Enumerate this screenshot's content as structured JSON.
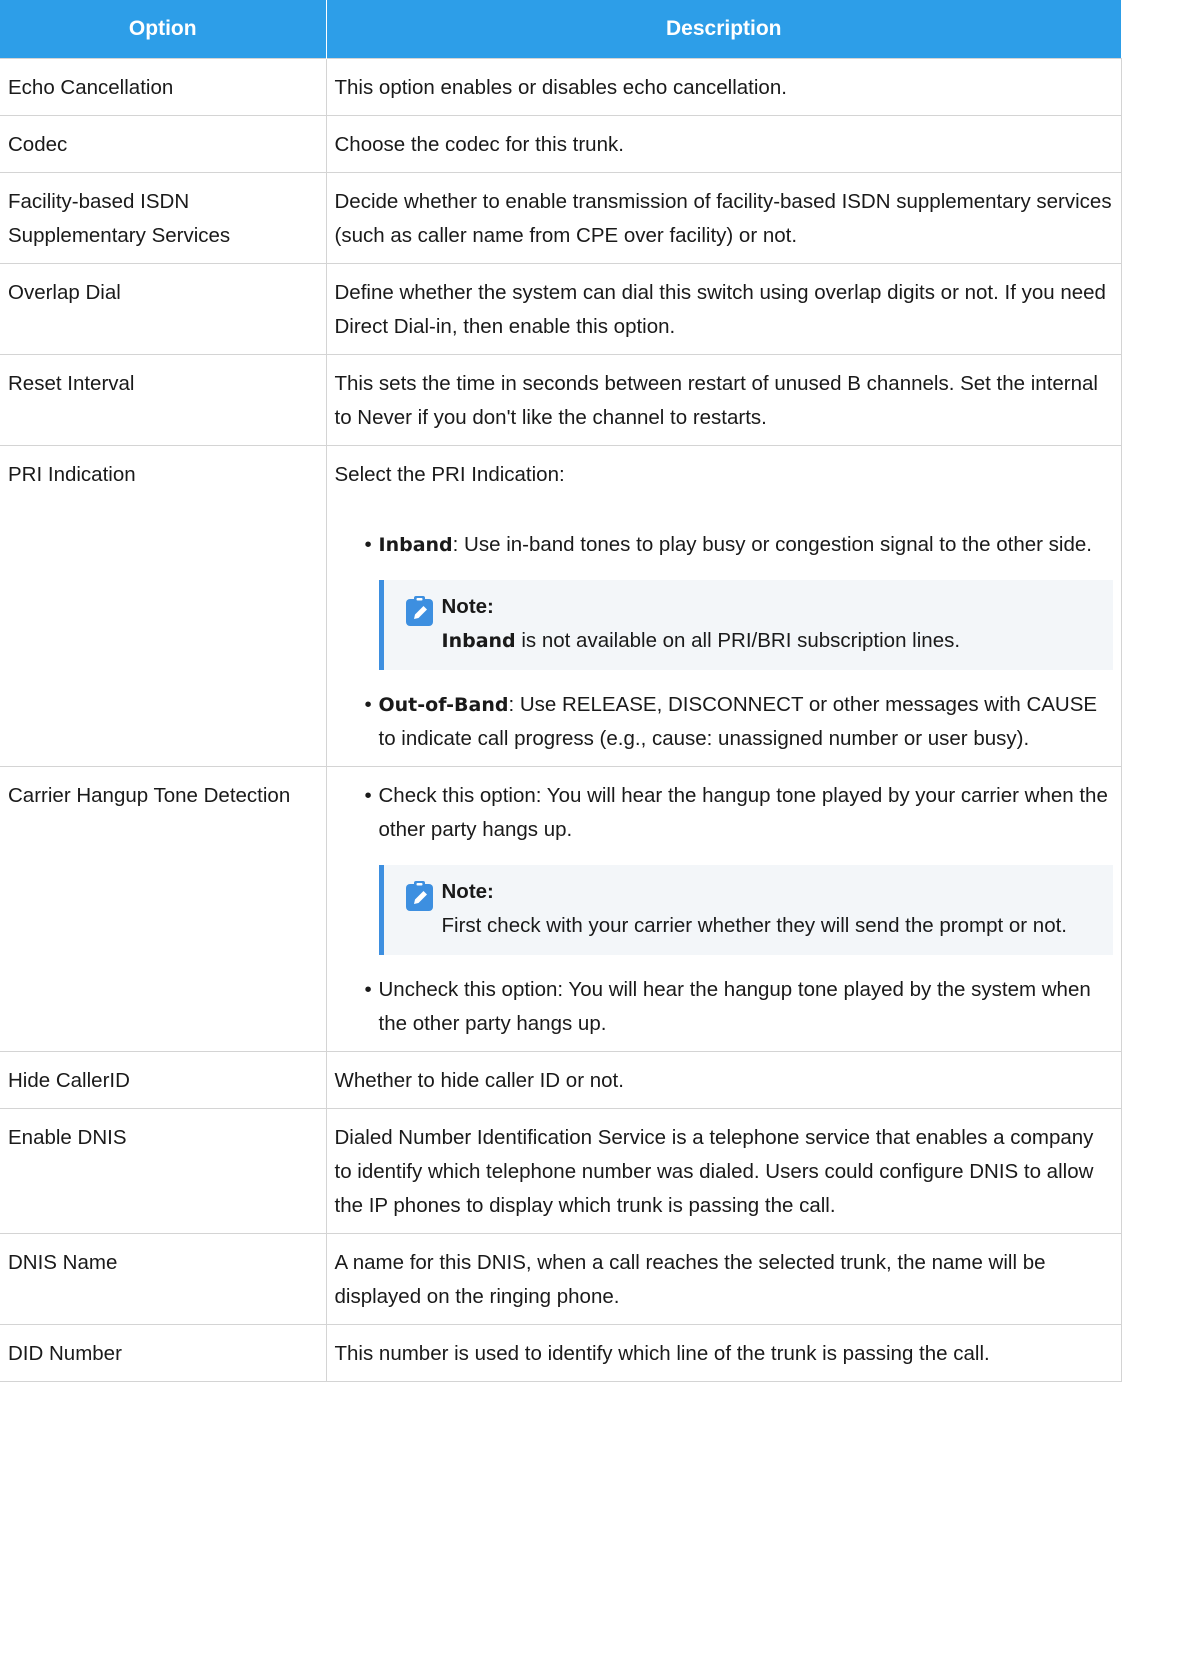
{
  "table": {
    "headers": {
      "option": "Option",
      "description": "Description"
    },
    "rows": [
      {
        "option": "Echo Cancellation",
        "description": "This option enables or disables echo cancellation."
      },
      {
        "option": "Codec",
        "description": "Choose the codec for this trunk."
      },
      {
        "option": "Facility-based ISDN Supplementary Services",
        "description": "Decide whether to enable transmission of facility-based ISDN supplementary services (such as caller name from CPE over facility) or not."
      },
      {
        "option": "Overlap Dial",
        "description": "Define whether the system can dial this switch using overlap digits or not. If you need Direct Dial-in, then enable this option."
      },
      {
        "option": "Reset Interval",
        "description": "This sets the time in seconds between restart of unused B channels. Set the internal to Never if you don't like the channel to restarts."
      },
      {
        "option": "PRI Indication",
        "intro": "Select the PRI Indication:",
        "items": [
          {
            "keyword": "Inband",
            "text": ": Use in-band tones to play busy or congestion signal to the other side.",
            "note": {
              "title": "Note:",
              "keyword": "Inband",
              "text": " is not available on all PRI/BRI subscription lines."
            }
          },
          {
            "keyword": "Out-of-Band",
            "text": ": Use RELEASE, DISCONNECT or other messages with CAUSE to indicate call progress (e.g., cause: unassigned number or user busy)."
          }
        ]
      },
      {
        "option": "Carrier Hangup Tone Detection",
        "items": [
          {
            "text": "Check this option: You will hear the hangup tone played by your carrier when the other party hangs up.",
            "note": {
              "title": "Note:",
              "text": "First check with your carrier whether they will send the prompt or not."
            }
          },
          {
            "text": "Uncheck this option: You will hear the hangup tone played by the system when the other party hangs up."
          }
        ]
      },
      {
        "option": "Hide CallerID",
        "description": "Whether to hide caller ID or not."
      },
      {
        "option": "Enable DNIS",
        "description": "Dialed Number Identification Service is a telephone service that enables a company to identify which telephone number was dialed. Users could configure DNIS to allow the IP phones to display which trunk is passing the call."
      },
      {
        "option": "DNIS Name",
        "description": "A name for this DNIS, when a call reaches the selected trunk, the name will be displayed on the ringing phone."
      },
      {
        "option": "DID Number",
        "description": "This number is used to identify which line of the trunk is passing the call."
      }
    ]
  },
  "icons": {
    "note": "pencil-note-icon",
    "bullet": "•"
  },
  "colors": {
    "header_bg": "#2d9ee8",
    "note_bg": "#f3f6f9",
    "note_border": "#3d8fe0"
  }
}
